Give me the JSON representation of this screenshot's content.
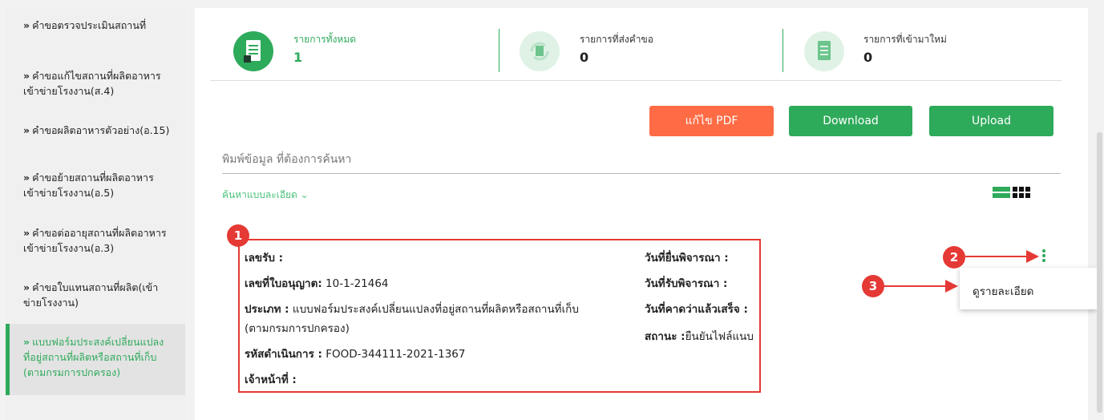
{
  "sidebar": {
    "items": [
      {
        "lines": [
          "คำขอตรวจประเมินสถานที่"
        ]
      },
      {
        "lines": [
          "คำขอแก้ไขสถานที่ผลิตอาหาร",
          "เข้าข่ายโรงงาน(ส.4)"
        ]
      },
      {
        "lines": [
          "คำขอผลิตอาหารตัวอย่าง(อ.15)"
        ]
      },
      {
        "lines": [
          "คำขอย้ายสถานที่ผลิตอาหาร",
          "เข้าข่ายโรงงาน(อ.5)"
        ]
      },
      {
        "lines": [
          "คำขอต่ออายุสถานที่ผลิตอาหาร",
          "เข้าข่ายโรงงาน(อ.3)"
        ]
      },
      {
        "lines": [
          "คำขอใบแทนสถานที่ผลิต(เข้า",
          "ข่ายโรงงาน)"
        ]
      },
      {
        "lines": [
          "แบบฟอร์มประสงค์เปลี่ยนแปลง",
          "ที่อยู่สถานที่ผลิตหรือสถานที่เก็บ",
          "(ตามกรมการปกครอง)"
        ]
      }
    ],
    "arrow": "»",
    "active_index": 6
  },
  "stats": [
    {
      "label": "รายการทั้งหมด",
      "value": "1",
      "icon": "document-icon"
    },
    {
      "label": "รายการที่ส่งคำขอ",
      "value": "0",
      "icon": "sync-document-icon"
    },
    {
      "label": "รายการที่เข้ามาใหม่",
      "value": "0",
      "icon": "new-document-icon"
    }
  ],
  "buttons": {
    "edit_pdf": "แก้ไข PDF",
    "download": "Download",
    "upload": "Upload"
  },
  "search": {
    "placeholder": "พิมพ์ข้อมูล ที่ต้องการค้นหา",
    "advanced": "ค้นหาแบบละเอียด ⌄"
  },
  "record": {
    "left": [
      {
        "label": "เลขรับ :",
        "value": ""
      },
      {
        "label": "เลขที่ใบอนุญาต:",
        "value": " 10-1-21464"
      },
      {
        "label": "ประเภท :",
        "value": " แบบฟอร์มประสงค์เปลี่ยนแปลงที่อยู่สถานที่ผลิตหรือสถานที่เก็บ"
      },
      {
        "label": "",
        "value": "(ตามกรมการปกครอง)"
      },
      {
        "label": "รหัสดำเนินการ :",
        "value": " FOOD-344111-2021-1367"
      },
      {
        "label": "เจ้าหน้าที่ :",
        "value": ""
      }
    ],
    "right": [
      {
        "label": "วันที่ยื่นพิจารณา :",
        "value": ""
      },
      {
        "label": "วันที่รับพิจารณา :",
        "value": ""
      },
      {
        "label": "วันที่คาดว่าแล้วเสร็จ :",
        "value": ""
      },
      {
        "label": "สถานะ :",
        "value": "ยืนยันไฟล์แนบ"
      }
    ]
  },
  "menu": {
    "item": "ดูรายละเอียด"
  },
  "callouts": [
    "1",
    "2",
    "3"
  ],
  "colors": {
    "green": "#2eaa5b",
    "orange": "#ff6b45",
    "red": "#e53935"
  }
}
